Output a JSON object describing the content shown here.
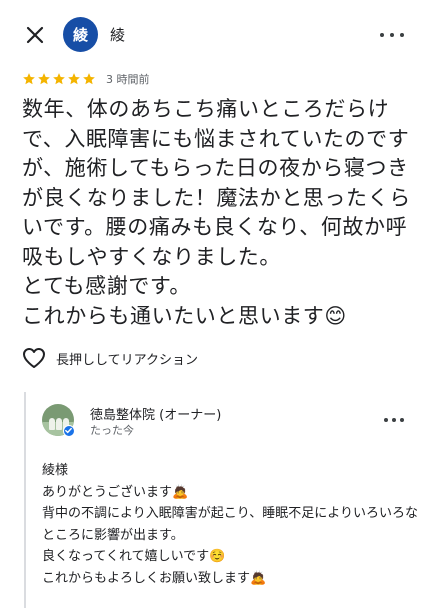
{
  "header": {
    "avatar_letter": "綾",
    "reviewer_name": "綾"
  },
  "rating": {
    "stars": 5,
    "star_color": "#f4b400",
    "time": "3 時間前"
  },
  "review": {
    "text": "数年、体のあちこち痛いところだらけで、入眠障害にも悩まされていたのですが、施術してもらった日の夜から寝つきが良くなりました！魔法かと思ったくらいです。腰の痛みも良くなり、何故か呼吸もしやすくなりました。\nとても感謝です。\nこれからも通いたいと思います😊"
  },
  "reaction": {
    "label": "長押ししてリアクション"
  },
  "owner_reply": {
    "owner_name": "徳島整体院 (オーナー)",
    "time": "たった今",
    "text": "綾様\nありがとうございます🙇\n背中の不調により入眠障害が起こり、睡眠不足によりいろいろなところに影響が出ます。\n良くなってくれて嬉しいです☺️\nこれからもよろしくお願い致します🙇"
  },
  "colors": {
    "avatar_bg": "#174ea6",
    "verified_badge": "#1a73e8"
  },
  "icons": [
    "close-icon",
    "more-vert-icon",
    "star-icon",
    "heart-outline-icon",
    "verified-check-icon"
  ]
}
